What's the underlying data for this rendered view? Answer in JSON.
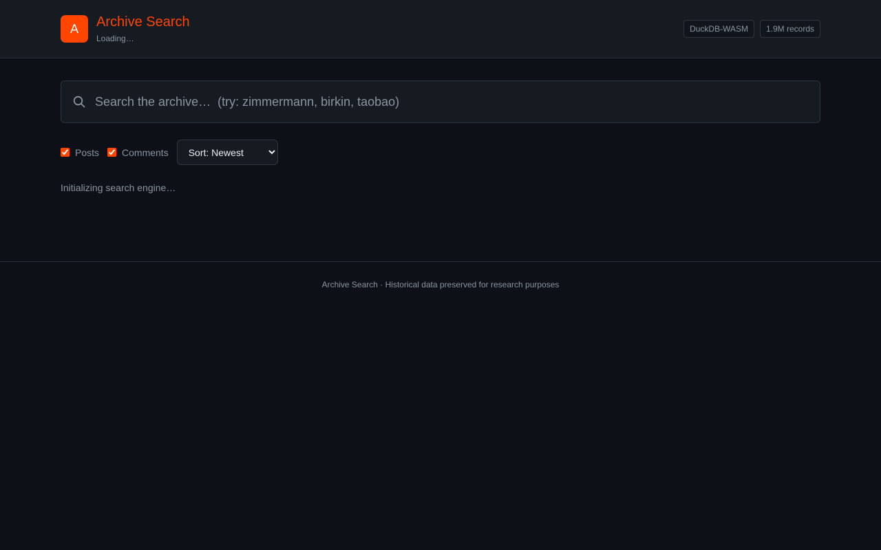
{
  "header": {
    "logo_letter": "A",
    "title": "Archive Search",
    "status": "Loading…",
    "badges": [
      "DuckDB-WASM",
      "1.9M records"
    ]
  },
  "search": {
    "icon": "search-icon",
    "placeholder": "Search the archive…  (try: zimmermann, birkin, taobao)",
    "value": ""
  },
  "filters": {
    "posts_label": "Posts",
    "posts_checked": true,
    "comments_label": "Comments",
    "comments_checked": true,
    "sort_selected": "Sort: Newest"
  },
  "results": {
    "status_message": "Initializing search engine…"
  },
  "footer": {
    "text": "Archive Search · Historical data preserved for research purposes"
  },
  "colors": {
    "accent": "#ff4500",
    "background": "#0d1017",
    "surface": "#161b22",
    "border": "#30363d",
    "muted_text": "#8b949e"
  }
}
